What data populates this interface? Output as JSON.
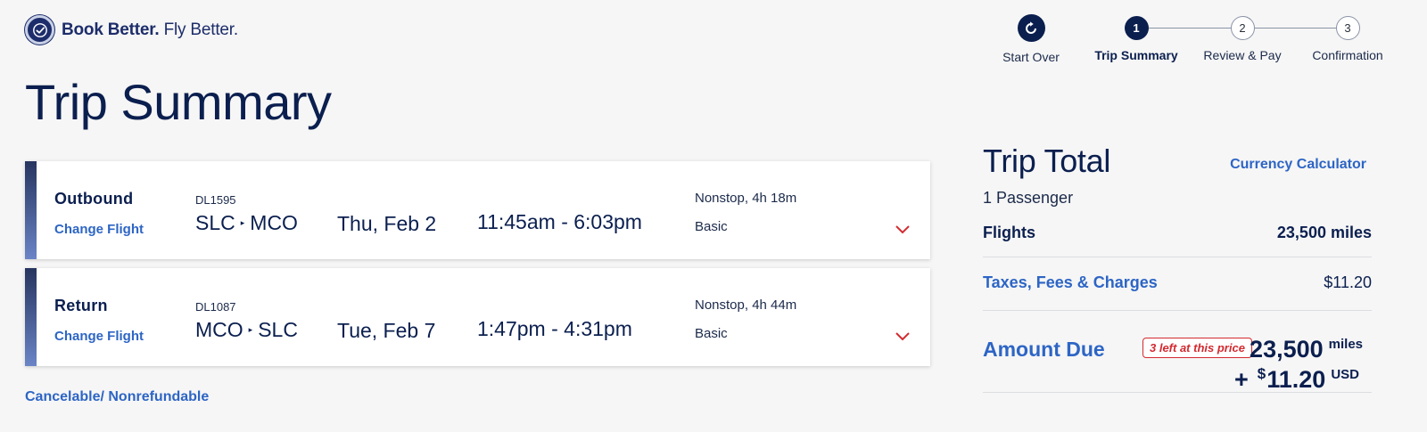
{
  "brand": {
    "logo_icon": "checkmark-seal-icon",
    "tagline_bold": "Book Better.",
    "tagline_regular": " Fly Better."
  },
  "stepper": {
    "start_over": {
      "label": "Start Over",
      "icon": "restart-icon"
    },
    "steps": [
      {
        "number": "1",
        "label": "Trip Summary",
        "active": true
      },
      {
        "number": "2",
        "label": "Review & Pay",
        "active": false
      },
      {
        "number": "3",
        "label": "Confirmation",
        "active": false
      }
    ]
  },
  "page": {
    "title": "Trip Summary"
  },
  "flights": [
    {
      "leg": "Outbound",
      "change_label": "Change Flight",
      "flight_number": "DL1595",
      "origin": "SLC",
      "destination": "MCO",
      "date": "Thu, Feb 2",
      "times": "11:45am - 6:03pm",
      "stops_duration": "Nonstop, 4h 18m",
      "fare_class": "Basic"
    },
    {
      "leg": "Return",
      "change_label": "Change Flight",
      "flight_number": "DL1087",
      "origin": "MCO",
      "destination": "SLC",
      "date": "Tue, Feb 7",
      "times": "1:47pm - 4:31pm",
      "stops_duration": "Nonstop, 4h 44m",
      "fare_class": "Basic"
    }
  ],
  "policy": {
    "text": "Cancelable/ Nonrefundable"
  },
  "trip_total": {
    "title": "Trip Total",
    "currency_calculator": "Currency Calculator",
    "passengers": "1 Passenger",
    "flights_label": "Flights",
    "flights_value": "23,500 miles",
    "taxes_label": "Taxes, Fees & Charges",
    "taxes_value": "$11.20",
    "amount_due_label": "Amount Due",
    "scarcity_badge": "3 left at this price",
    "due_miles": "23,500",
    "due_miles_unit": "miles",
    "due_plus": "+",
    "due_currency_symbol": "$",
    "due_usd": "11.20",
    "due_usd_unit": "USD"
  },
  "colors": {
    "navy": "#0b1f4f",
    "link_blue": "#2d65c5",
    "alert_red": "#d32a2f",
    "background": "#f6f6f6"
  }
}
